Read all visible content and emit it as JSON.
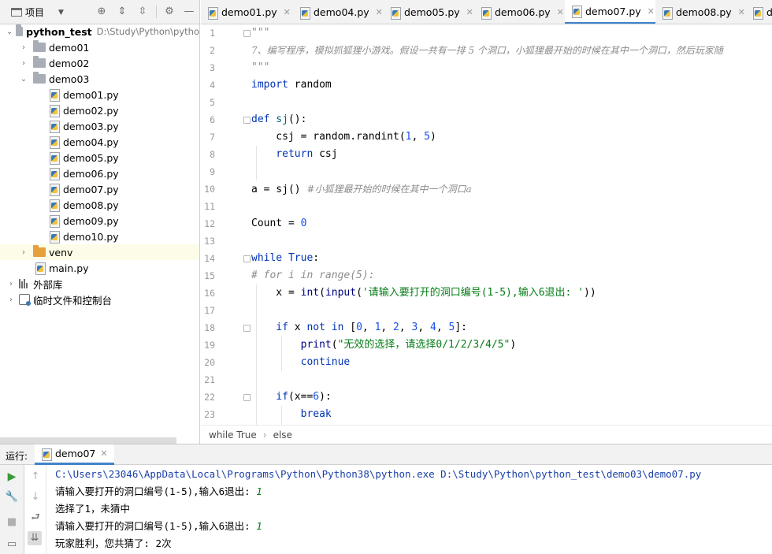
{
  "project": {
    "title": "项目",
    "root": "python_test",
    "root_path": "D:\\Study\\Python\\pytho",
    "folders": [
      "demo01",
      "demo02",
      "demo03"
    ],
    "files": [
      "demo01.py",
      "demo02.py",
      "demo03.py",
      "demo04.py",
      "demo05.py",
      "demo06.py",
      "demo07.py",
      "demo08.py",
      "demo09.py",
      "demo10.py"
    ],
    "venv": "venv",
    "main": "main.py",
    "external": "外部库",
    "scratches": "临时文件和控制台"
  },
  "tabs": [
    "demo01.py",
    "demo04.py",
    "demo05.py",
    "demo06.py",
    "demo07.py",
    "demo08.py",
    "d"
  ],
  "active_tab": "demo07.py",
  "editor": {
    "line_numbers": [
      "1",
      "2",
      "3",
      "4",
      "5",
      "6",
      "7",
      "8",
      "9",
      "10",
      "11",
      "12",
      "13",
      "14",
      "15",
      "16",
      "17",
      "18",
      "19",
      "20",
      "21",
      "22",
      "23"
    ],
    "doc_open": "\"\"\"",
    "doc_text": "7、编写程序，模拟抓狐狸小游戏。假设一共有一排 5 个洞口，小狐狸最开始的时候在其中一个洞口，然后玩家随",
    "doc_close": "\"\"\"",
    "import_kw": "import",
    "import_mod": " random",
    "def_kw": "def",
    "def_name": " sj",
    "def_rest": "():",
    "l7_a": "    csj = random.randint(",
    "l7_n1": "1",
    "l7_b": ", ",
    "l7_n2": "5",
    "l7_c": ")",
    "l8_kw": "    return",
    "l8_rest": " csj",
    "l10_code": "a = sj() ",
    "l10_cmt": "#小狐狸最开始的时候在其中一个洞口a",
    "l12_code": "Count = ",
    "l12_num": "0",
    "l14_kw": "while",
    "l14_true": " True",
    "l14_rest": ":",
    "l15_cmt": "# for i in range(5):",
    "l16_a": "    x = ",
    "l16_int": "int",
    "l16_b": "(",
    "l16_input": "input",
    "l16_c": "(",
    "l16_str": "'请输入要打开的洞口编号(1-5),输入6退出: '",
    "l16_d": "))",
    "l18_if": "    if",
    "l18_a": " x ",
    "l18_notin": "not in",
    "l18_b": " [",
    "l18_nums": [
      "0",
      "1",
      "2",
      "3",
      "4",
      "5"
    ],
    "l18_c": "]:",
    "l19_print": "        print",
    "l19_a": "(",
    "l19_str": "\"无效的选择，请选择0/1/2/3/4/5\"",
    "l19_b": ")",
    "l20_kw": "        continue",
    "l22_if": "    if",
    "l22_a": "(x==",
    "l22_num": "6",
    "l22_b": "):",
    "l23_kw": "        break"
  },
  "breadcrumb": [
    "while True",
    "else"
  ],
  "run": {
    "label": "运行:",
    "tab": "demo07",
    "cmd": "C:\\Users\\23046\\AppData\\Local\\Programs\\Python\\Python38\\python.exe D:\\Study\\Python\\python_test\\demo03\\demo07.py",
    "prompt1": "请输入要打开的洞口编号(1-5),输入6退出: ",
    "input1": "1",
    "out1": "选择了1，未猜中",
    "prompt2": "请输入要打开的洞口编号(1-5),输入6退出: ",
    "input2": "1",
    "out2": "玩家胜利，您共猜了: 2次"
  },
  "colors": {
    "accent": "#4083c9",
    "keyword": "#0033b3",
    "string": "#067d17",
    "number": "#1750eb",
    "comment": "#8c8c8c"
  }
}
